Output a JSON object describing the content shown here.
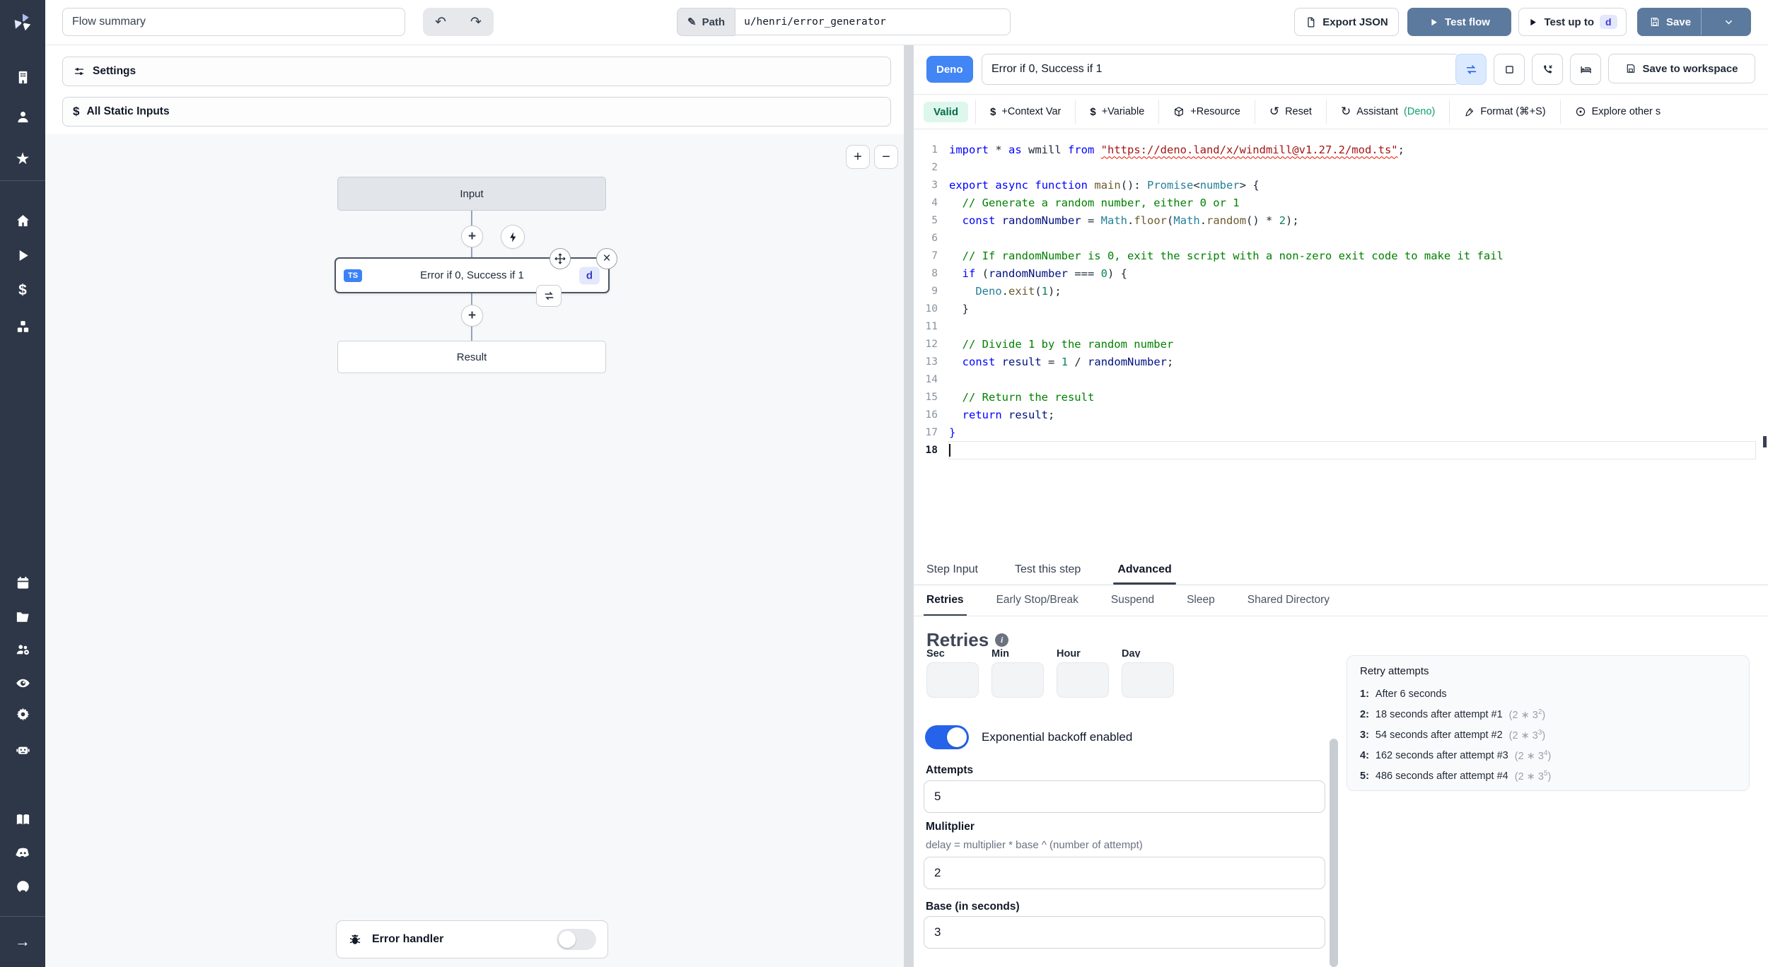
{
  "colors": {
    "sidebar_bg": "#2e3748",
    "primary_button_blue": "#5c7a9e",
    "deno_badge_blue": "#4285f4",
    "toggle_on_blue": "#2563eb",
    "valid_bg": "#def7ec",
    "valid_text": "#046c4e",
    "assistant_accent_green": "#0e9f6e",
    "step_chip_bg": "#e3e8fd",
    "step_chip_text": "#4338ca",
    "ts_badge_blue": "#3b82f6"
  },
  "topbar": {
    "flow_summary_value": "Flow summary",
    "path_label": "Path",
    "path_value": "u/henri/error_generator",
    "export_json_label": "Export JSON",
    "test_flow_label": "Test flow",
    "test_up_to_label": "Test up to",
    "test_up_to_step": "d",
    "save_label": "Save"
  },
  "sidebar_icons": [
    {
      "name": "workspace-icon",
      "icon": "building"
    },
    {
      "name": "user-icon",
      "icon": "user"
    },
    {
      "name": "favorites-icon",
      "icon": "star"
    },
    {
      "name": "home-icon",
      "icon": "home"
    },
    {
      "name": "runs-icon",
      "icon": "play"
    },
    {
      "name": "variables-icon",
      "icon": "dollar"
    },
    {
      "name": "resources-icon",
      "icon": "cubes"
    },
    {
      "name": "schedules-icon",
      "icon": "calendar"
    },
    {
      "name": "folders-icon",
      "icon": "folder"
    },
    {
      "name": "groups-icon",
      "icon": "users"
    },
    {
      "name": "audit-logs-icon",
      "icon": "eye"
    },
    {
      "name": "settings-icon",
      "icon": "gear"
    },
    {
      "name": "workers-icon",
      "icon": "robot"
    },
    {
      "name": "docs-icon",
      "icon": "book"
    },
    {
      "name": "discord-icon",
      "icon": "discord"
    },
    {
      "name": "github-icon",
      "icon": "github"
    },
    {
      "name": "expand-sidebar-icon",
      "icon": "arrowright"
    }
  ],
  "flow": {
    "settings_label": "Settings",
    "all_static_inputs_label": "All Static Inputs",
    "zoom_in": "+",
    "zoom_out": "−",
    "input_node": "Input",
    "step_node": {
      "lang": "TS",
      "title": "Error if 0, Success if 1",
      "id": "d"
    },
    "result_node": "Result",
    "error_handler_label": "Error handler"
  },
  "editor": {
    "lang_badge": "Deno",
    "title_value": "Error if 0, Success if 1",
    "save_to_workspace_label": "Save to workspace",
    "valid_label": "Valid",
    "toolbar": [
      {
        "name": "add-context-var",
        "icon": "dollar2",
        "label": "+Context Var"
      },
      {
        "name": "add-variable",
        "icon": "dollar2",
        "label": "+Variable"
      },
      {
        "name": "add-resource",
        "icon": "package",
        "label": "+Resource"
      },
      {
        "name": "reset",
        "icon": "reset",
        "label": "Reset"
      },
      {
        "name": "assistant",
        "icon": "refresh",
        "label": "Assistant ",
        "accent": "(Deno)"
      },
      {
        "name": "format",
        "icon": "wand",
        "label": "Format (⌘+S)"
      },
      {
        "name": "explore-scripts",
        "icon": "explore",
        "label": "Explore other s"
      }
    ],
    "code_lines": [
      [
        [
          "kw",
          "import"
        ],
        [
          "pl",
          " * "
        ],
        [
          "kw",
          "as"
        ],
        [
          "pl",
          " wmill "
        ],
        [
          "kw",
          "from"
        ],
        [
          "pl",
          " "
        ],
        [
          "str",
          "\"https://deno.land/x/windmill@v1.27.2/mod.ts\""
        ],
        [
          "pl",
          ";"
        ]
      ],
      [],
      [
        [
          "kw",
          "export"
        ],
        [
          "pl",
          " "
        ],
        [
          "kw",
          "async"
        ],
        [
          "pl",
          " "
        ],
        [
          "kw",
          "function"
        ],
        [
          "pl",
          " "
        ],
        [
          "fn",
          "main"
        ],
        [
          "pl",
          "(): "
        ],
        [
          "typ",
          "Promise"
        ],
        [
          "pl",
          "<"
        ],
        [
          "typ",
          "number"
        ],
        [
          "pl",
          "> {"
        ]
      ],
      [
        [
          "pl",
          "  "
        ],
        [
          "com",
          "// Generate a random number, either 0 or 1"
        ]
      ],
      [
        [
          "pl",
          "  "
        ],
        [
          "kw",
          "const"
        ],
        [
          "pl",
          " "
        ],
        [
          "var",
          "randomNumber"
        ],
        [
          "pl",
          " = "
        ],
        [
          "typ",
          "Math"
        ],
        [
          "pl",
          "."
        ],
        [
          "fn",
          "floor"
        ],
        [
          "pl",
          "("
        ],
        [
          "typ",
          "Math"
        ],
        [
          "pl",
          "."
        ],
        [
          "fn",
          "random"
        ],
        [
          "pl",
          "() * "
        ],
        [
          "num",
          "2"
        ],
        [
          "pl",
          ");"
        ]
      ],
      [],
      [
        [
          "pl",
          "  "
        ],
        [
          "com",
          "// If randomNumber is 0, exit the script with a non-zero exit code to make it fail"
        ]
      ],
      [
        [
          "pl",
          "  "
        ],
        [
          "kw",
          "if"
        ],
        [
          "pl",
          " ("
        ],
        [
          "var",
          "randomNumber"
        ],
        [
          "pl",
          " === "
        ],
        [
          "num",
          "0"
        ],
        [
          "pl",
          ") {"
        ]
      ],
      [
        [
          "pl",
          "    "
        ],
        [
          "typ",
          "Deno"
        ],
        [
          "pl",
          "."
        ],
        [
          "fn",
          "exit"
        ],
        [
          "pl",
          "("
        ],
        [
          "num",
          "1"
        ],
        [
          "pl",
          ");"
        ]
      ],
      [
        [
          "pl",
          "  }"
        ]
      ],
      [],
      [
        [
          "pl",
          "  "
        ],
        [
          "com",
          "// Divide 1 by the random number"
        ]
      ],
      [
        [
          "pl",
          "  "
        ],
        [
          "kw",
          "const"
        ],
        [
          "pl",
          " "
        ],
        [
          "var",
          "result"
        ],
        [
          "pl",
          " = "
        ],
        [
          "num",
          "1"
        ],
        [
          "pl",
          " / "
        ],
        [
          "var",
          "randomNumber"
        ],
        [
          "pl",
          ";"
        ]
      ],
      [],
      [
        [
          "pl",
          "  "
        ],
        [
          "com",
          "// Return the result"
        ]
      ],
      [
        [
          "pl",
          "  "
        ],
        [
          "kw",
          "return"
        ],
        [
          "pl",
          " "
        ],
        [
          "var",
          "result"
        ],
        [
          "pl",
          ";"
        ]
      ],
      [
        [
          "kw",
          "}"
        ]
      ],
      []
    ]
  },
  "panel": {
    "tabs": [
      {
        "label": "Step Input",
        "active": false
      },
      {
        "label": "Test this step",
        "active": false
      },
      {
        "label": "Advanced",
        "active": true
      }
    ],
    "subtabs": [
      {
        "label": "Retries",
        "active": true
      },
      {
        "label": "Early Stop/Break",
        "active": false
      },
      {
        "label": "Suspend",
        "active": false
      },
      {
        "label": "Sleep",
        "active": false
      },
      {
        "label": "Shared Directory",
        "active": false
      }
    ],
    "retries": {
      "heading": "Retries",
      "units": [
        "Sec",
        "Min",
        "Hour",
        "Day"
      ],
      "toggle_label": "Exponential backoff enabled",
      "toggle_on": true,
      "attempts_label": "Attempts",
      "attempts_value": "5",
      "multiplier_label": "Mulitplier",
      "multiplier_hint": "delay = multiplier * base ^ (number of attempt)",
      "multiplier_value": "2",
      "base_label": "Base (in seconds)",
      "base_value": "3"
    },
    "retry_attempts": {
      "title": "Retry attempts",
      "items": [
        {
          "n": "1:",
          "text": "After 6 seconds",
          "fbase": "",
          "fexp": ""
        },
        {
          "n": "2:",
          "text": "18 seconds after attempt #1",
          "fbase": "2 * 3",
          "fexp": "2"
        },
        {
          "n": "3:",
          "text": "54 seconds after attempt #2",
          "fbase": "2 * 3",
          "fexp": "3"
        },
        {
          "n": "4:",
          "text": "162 seconds after attempt #3",
          "fbase": "2 * 3",
          "fexp": "4"
        },
        {
          "n": "5:",
          "text": "486 seconds after attempt #4",
          "fbase": "2 * 3",
          "fexp": "5"
        }
      ]
    }
  }
}
